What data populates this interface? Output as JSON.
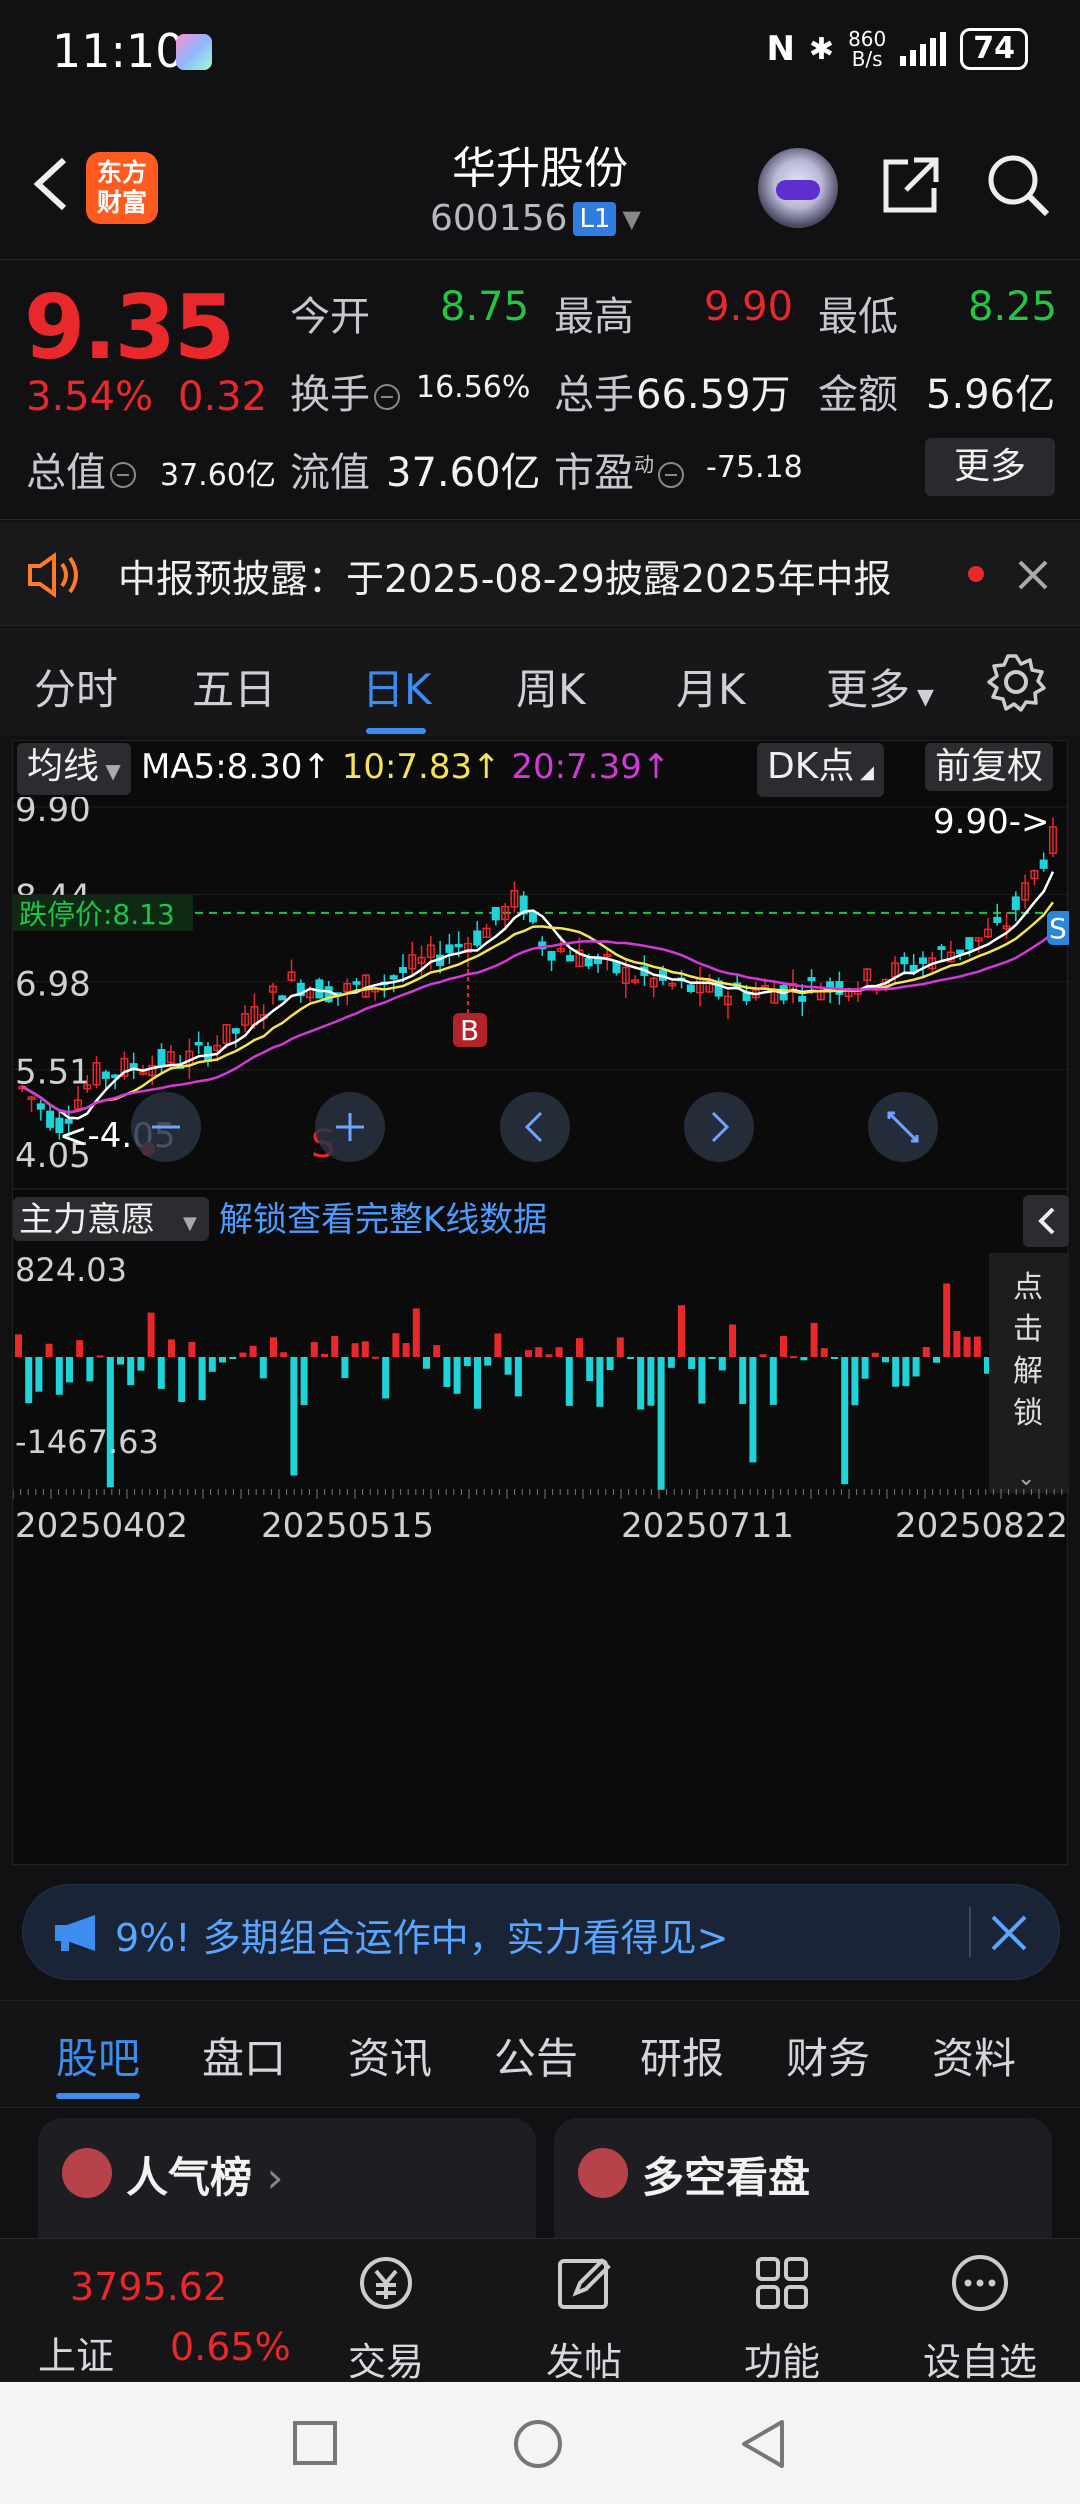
{
  "status_bar": {
    "time": "11:10",
    "net_speed_top": "860",
    "net_speed_bottom": "B/s",
    "battery": "74"
  },
  "header": {
    "logo_line1": "东方",
    "logo_line2": "财富",
    "title": "华升股份",
    "code": "600156",
    "level_badge": "L1"
  },
  "quote": {
    "price": "9.35",
    "change_pct": "3.54%",
    "change": "0.32",
    "open_label": "今开",
    "open": "8.75",
    "high_label": "最高",
    "high": "9.90",
    "low_label": "最低",
    "low": "8.25",
    "turnover_label": "换手",
    "turnover": "16.56%",
    "volume_label": "总手",
    "volume": "66.59万",
    "amount_label": "金额",
    "amount": "5.96亿",
    "mktcap_label": "总值",
    "mktcap": "37.60亿",
    "float_label": "流值",
    "float": "37.60亿",
    "pe_label": "市盈",
    "pe_sup": "动",
    "pe": "-75.18",
    "more_label": "更多"
  },
  "notice": {
    "text": "中报预披露：于2025-08-29披露2025年中报"
  },
  "period_tabs": [
    "分时",
    "五日",
    "日K",
    "周K",
    "月K",
    "更多"
  ],
  "active_period": "日K",
  "chart": {
    "indicator_select": "均线",
    "ma5": "MA5:8.30↑",
    "ma10": "10:7.83↑",
    "ma20": "20:7.39↑",
    "dk_label": "DK点",
    "adjust_label": "前复权",
    "y_labels": [
      "9.90",
      "8.44",
      "6.98",
      "5.51",
      "4.05"
    ],
    "limit_down_label": "跌停价:8.13",
    "max_marker": "9.90->",
    "min_marker": "<-4.05",
    "marker_b": "B",
    "marker_s": "S",
    "marker_s2": "S",
    "colors": {
      "up": "#e8282b",
      "down": "#1fd4d8",
      "ma5": "#ffffff",
      "ma10": "#f3e25a",
      "ma20": "#d23ad8",
      "limit": "#22c24a"
    },
    "sub_select": "主力意愿",
    "unlock_text": "解锁查看完整K线数据",
    "sub_max": "824.03",
    "sub_min": "-1467.63",
    "unlock_side": "点击解锁",
    "dates": [
      "20250402",
      "20250515",
      "20250711",
      "20250822"
    ],
    "zoom_buttons": [
      "zoom-out",
      "zoom-in",
      "prev",
      "next",
      "fullscreen"
    ]
  },
  "chart_data": {
    "type": "candlestick",
    "y_axis": [
      4.05,
      9.9
    ],
    "limit_down": 8.13,
    "dates_shown": [
      "20250402",
      "20250515",
      "20250711",
      "20250822"
    ],
    "ma": {
      "MA5": 8.3,
      "MA10": 7.83,
      "MA20": 7.39
    },
    "sub_range": [
      -1467.63,
      824.03
    ]
  },
  "ad": {
    "text": "9%!  多期组合运作中，实力看得见>"
  },
  "bottom_tabs": [
    "股吧",
    "盘口",
    "资讯",
    "公告",
    "研报",
    "财务",
    "资料"
  ],
  "active_bottom_tab": "股吧",
  "cards": [
    {
      "title": "人气榜"
    },
    {
      "title": "多空看盘"
    }
  ],
  "bottom_bar": {
    "index_value": "3795.62",
    "index_name": "上证",
    "index_change": "0.65%",
    "trade": "交易",
    "post": "发帖",
    "func": "功能",
    "watch": "设自选"
  }
}
